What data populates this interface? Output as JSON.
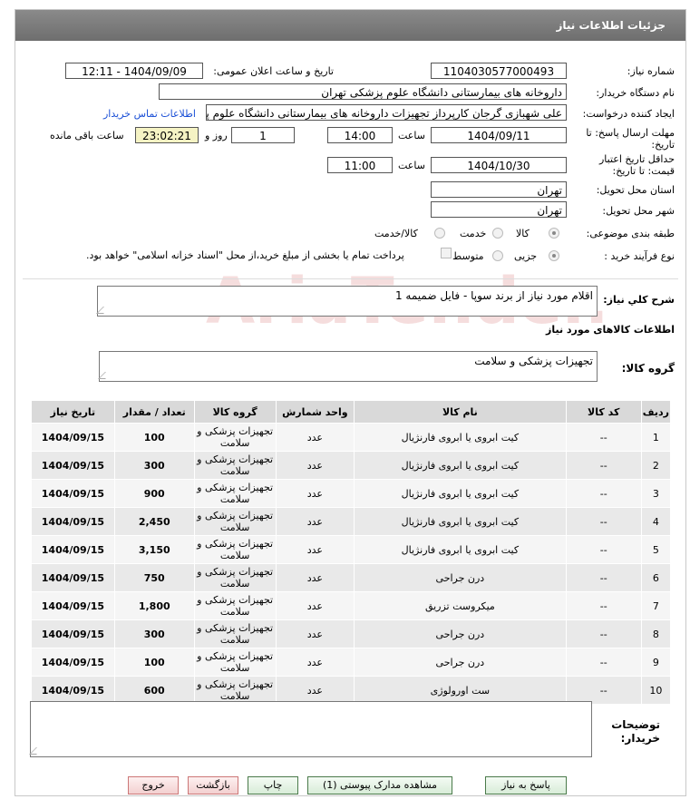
{
  "header": {
    "title": "جزئیات اطلاعات نیاز"
  },
  "form": {
    "need_number_label": "شماره نیاز:",
    "need_number": "1104030577000493",
    "announce_label": "تاریخ و ساعت اعلان عمومی:",
    "announce_value": "1404/09/09 - 12:11",
    "buyer_org_label": "نام دستگاه خریدار:",
    "buyer_org": "داروخانه های بیمارستانی دانشگاه علوم پزشکی تهران",
    "requester_label": "ایجاد کننده درخواست:",
    "requester": "علی شهبازی گرجان کارپرداز تجهیزات داروخانه های بیمارستانی دانشگاه علوم پزشکی تهران",
    "contact_link": "اطلاعات تماس خریدار",
    "deadline_label_1": "مهلت ارسال پاسخ: تا",
    "deadline_label_2": "تاریخ:",
    "deadline_date": "1404/09/11",
    "time_label": "ساعت",
    "deadline_time": "14:00",
    "days_value": "1",
    "days_label": "روز و",
    "remaining_time": "23:02:21",
    "remaining_label": "ساعت باقی مانده",
    "validity_label_1": "حداقل تاریخ اعتبار",
    "validity_label_2": "قیمت: تا تاریخ:",
    "validity_date": "1404/10/30",
    "validity_time_label": "ساعت",
    "validity_time": "11:00",
    "province_label": "استان محل تحویل:",
    "province": "تهران",
    "city_label": "شهر محل تحویل:",
    "city": "تهران",
    "category_label": "طبقه بندی موضوعی:",
    "category_options": [
      "کالا",
      "خدمت",
      "کالا/خدمت"
    ],
    "process_label": "نوع فرآیند خرید :",
    "process_options": [
      "جزیی",
      "متوسط"
    ],
    "payment_note": "پرداخت تمام یا بخشی از مبلغ خرید،از محل \"اسناد خزانه اسلامی\" خواهد بود."
  },
  "description": {
    "label": "شرح كلي نياز:",
    "value": "اقلام مورد نیاز از برند سوپا - فایل ضمیمه 1"
  },
  "goods_section_title": "اطلاعات کالاهای مورد نیاز",
  "goods_group": {
    "label": "گروه کالا:",
    "value": "تجهیزات پزشکی و سلامت"
  },
  "table": {
    "headers": [
      "ردیف",
      "کد کالا",
      "نام کالا",
      "واحد شمارش",
      "گروه کالا",
      "تعداد / مقدار",
      "تاریخ نیاز"
    ],
    "rows": [
      {
        "row": "1",
        "code": "--",
        "name": "کیت ابروی یا ابروی فارنژیال",
        "unit": "عدد",
        "group": "تجهیزات پزشکی و سلامت",
        "qty": "100",
        "date": "1404/09/15"
      },
      {
        "row": "2",
        "code": "--",
        "name": "کیت ابروی یا ابروی فارنژیال",
        "unit": "عدد",
        "group": "تجهیزات پزشکی و سلامت",
        "qty": "300",
        "date": "1404/09/15"
      },
      {
        "row": "3",
        "code": "--",
        "name": "کیت ابروی یا ابروی فارنژیال",
        "unit": "عدد",
        "group": "تجهیزات پزشکی و سلامت",
        "qty": "900",
        "date": "1404/09/15"
      },
      {
        "row": "4",
        "code": "--",
        "name": "کیت ابروی یا ابروی فارنژیال",
        "unit": "عدد",
        "group": "تجهیزات پزشکی و سلامت",
        "qty": "2,450",
        "date": "1404/09/15"
      },
      {
        "row": "5",
        "code": "--",
        "name": "کیت ابروی یا ابروی فارنژیال",
        "unit": "عدد",
        "group": "تجهیزات پزشکی و سلامت",
        "qty": "3,150",
        "date": "1404/09/15"
      },
      {
        "row": "6",
        "code": "--",
        "name": "درن جراحی",
        "unit": "عدد",
        "group": "تجهیزات پزشکی و سلامت",
        "qty": "750",
        "date": "1404/09/15"
      },
      {
        "row": "7",
        "code": "--",
        "name": "میکروست تزریق",
        "unit": "عدد",
        "group": "تجهیزات پزشکی و سلامت",
        "qty": "1,800",
        "date": "1404/09/15"
      },
      {
        "row": "8",
        "code": "--",
        "name": "درن جراحی",
        "unit": "عدد",
        "group": "تجهیزات پزشکی و سلامت",
        "qty": "300",
        "date": "1404/09/15"
      },
      {
        "row": "9",
        "code": "--",
        "name": "درن جراحی",
        "unit": "عدد",
        "group": "تجهیزات پزشکی و سلامت",
        "qty": "100",
        "date": "1404/09/15"
      },
      {
        "row": "10",
        "code": "--",
        "name": "ست اورولوژی",
        "unit": "عدد",
        "group": "تجهیزات پزشکی و سلامت",
        "qty": "600",
        "date": "1404/09/15"
      }
    ]
  },
  "buyer_notes": {
    "label_1": "توضیحات",
    "label_2": "خریدار:",
    "value": ""
  },
  "buttons": {
    "reply": "پاسخ به نیاز",
    "attachments": "مشاهده مدارک پیوستی (1)",
    "print": "چاپ",
    "back": "بازگشت",
    "exit": "خروج"
  },
  "watermark_text": "AriaTender.neT"
}
